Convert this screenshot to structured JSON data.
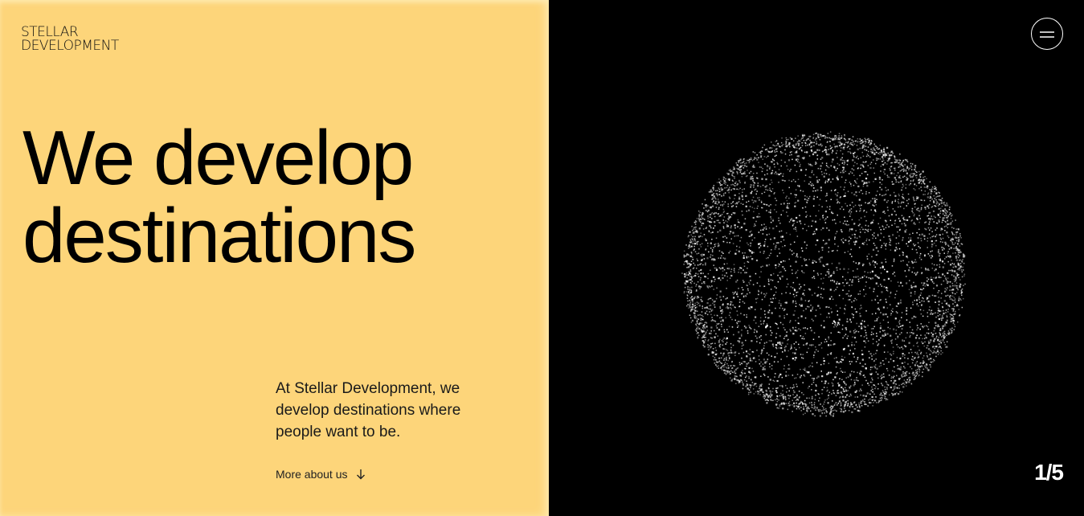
{
  "logo": {
    "line1": "STELLAR",
    "line2": "DEVELOPMENT"
  },
  "hero": {
    "headline_line1": "We develop",
    "headline_line2": "destinations",
    "intro": "At Stellar Development, we develop destinations where people want to be.",
    "more_link": "More about us"
  },
  "nav": {
    "menu_icon": "hamburger-icon"
  },
  "slider": {
    "counter": "1/5",
    "current": 1,
    "total": 5
  },
  "colors": {
    "left_background": "#FDD57A",
    "right_background": "#000000",
    "text_dark": "#111111",
    "text_light": "#FFFFFF"
  }
}
